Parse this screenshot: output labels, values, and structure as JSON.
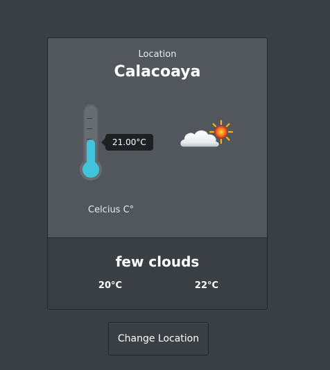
{
  "weather": {
    "location_label": "Location",
    "location_name": "Calacoaya",
    "temperature": "21.00°C",
    "thermometer_level": 0.45,
    "unit_label": "Celcius C°",
    "icon": "few-clouds-icon",
    "description": "few clouds",
    "temp_min": "20°C",
    "temp_max": "22°C"
  },
  "actions": {
    "change_location_label": "Change Location"
  },
  "colors": {
    "background": "#3a3f44",
    "card_top": "#52575d",
    "thermometer_fill": "#41c3dc",
    "tooltip_bg": "#1e2124"
  }
}
